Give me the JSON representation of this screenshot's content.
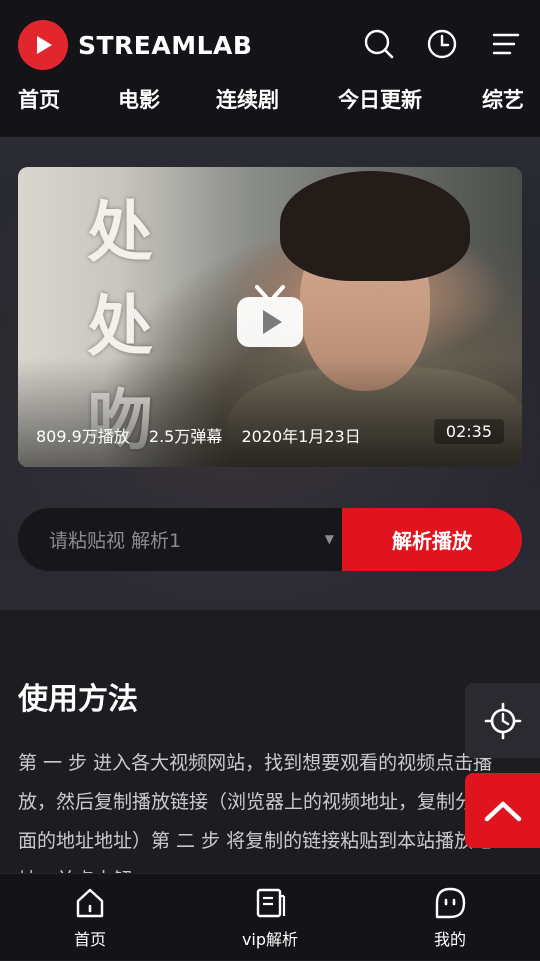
{
  "header": {
    "brand": "STREAMLAB",
    "icons": [
      "search-icon",
      "history-icon",
      "menu-icon"
    ]
  },
  "nav": {
    "items": [
      {
        "label": "首页"
      },
      {
        "label": "电影"
      },
      {
        "label": "连续剧"
      },
      {
        "label": "今日更新"
      },
      {
        "label": "综艺"
      }
    ]
  },
  "featured": {
    "title_art": "处处吻",
    "plays": "809.9万播放",
    "danmaku": "2.5万弹幕",
    "date": "2020年1月23日",
    "duration": "02:35"
  },
  "parse": {
    "placeholder": "请粘贴视 解析1",
    "button": "解析播放"
  },
  "content": {
    "title": "使用方法",
    "paragraph": "第 一 步 进入各大视频网站，找到想要观看的视频点击播放，然后复制播放链接（浏览器上的视频地址，复制分享里面的地址地址）第 二 步 将复制的链接粘贴到本站播放地址，并点击解"
  },
  "tabbar": {
    "items": [
      {
        "label": "首页",
        "icon": "home-icon"
      },
      {
        "label": "vip解析",
        "icon": "document-icon"
      },
      {
        "label": "我的",
        "icon": "profile-icon"
      }
    ]
  },
  "colors": {
    "accent": "#e0141e",
    "background": "#1c1c21",
    "header": "#141418"
  }
}
